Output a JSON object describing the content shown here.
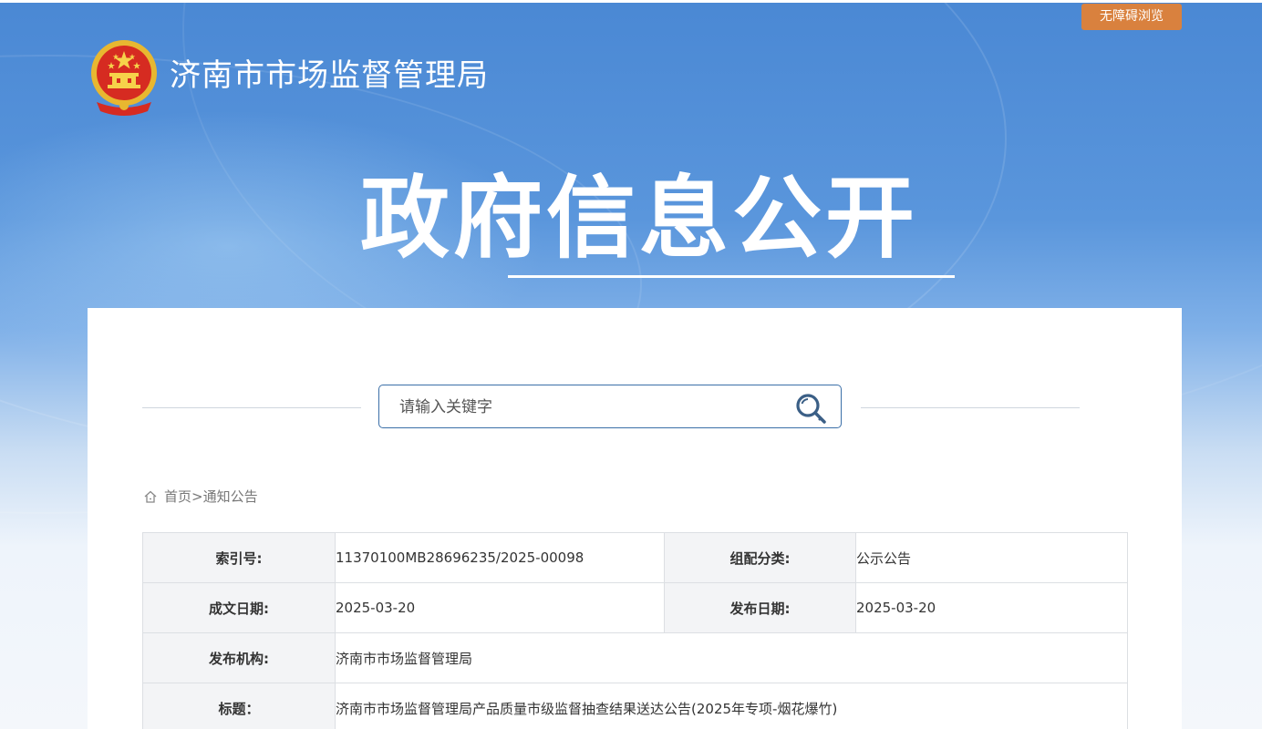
{
  "header": {
    "accessibility_label": "无障碍浏览",
    "site_title": "济南市市场监督管理局",
    "hero_title": "政府信息公开"
  },
  "search": {
    "placeholder": "请输入关键字"
  },
  "breadcrumb": {
    "home": "首页",
    "separator": ">",
    "current": "通知公告"
  },
  "meta": {
    "index_no_label": "索引号:",
    "index_no": "11370100MB28696235/2025-00098",
    "category_label": "组配分类:",
    "category": "公示公告",
    "created_label": "成文日期:",
    "created": "2025-03-20",
    "published_label": "发布日期:",
    "published": "2025-03-20",
    "issuer_label": "发布机构:",
    "issuer": "济南市市场监督管理局",
    "title_label": "标题：",
    "title": "济南市市场监督管理局产品质量市级监督抽查结果送达公告(2025年专项-烟花爆竹)"
  },
  "colors": {
    "accent_orange": "#d9813e",
    "border_blue": "#3b6fa8",
    "banner_blue": "#4a88d4"
  }
}
